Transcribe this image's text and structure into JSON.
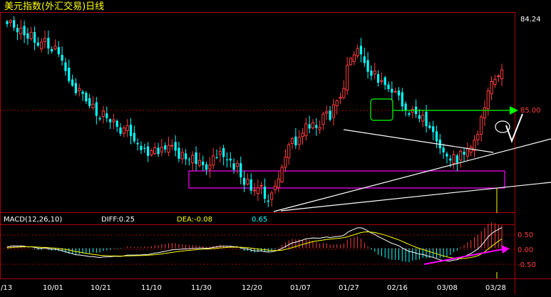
{
  "title": "美元指数(外汇交易)日线",
  "price_labels": {
    "top": "84.24",
    "level": "85.00"
  },
  "macd": {
    "label": "MACD(12,26,10)",
    "diff": "DIFF:0.25",
    "dea": "DEA:-0.08",
    "macd": "0.65",
    "ticks": [
      "0.50",
      "0.00",
      "-0.50"
    ]
  },
  "x_axis": {
    "labels": [
      "/13",
      "10/01",
      "10/21",
      "11/10",
      "11/30",
      "12/20",
      "01/07",
      "01/27",
      "02/16",
      "03/08",
      "03/28"
    ]
  },
  "colors": {
    "up": "#ff3c3c",
    "down": "#00ffff",
    "bg": "#000000",
    "frame": "#aa0000",
    "diff": "#ffffff",
    "dea": "#ffff00",
    "support": "#ff00ff",
    "target": "#00ff00"
  },
  "chart_data": {
    "type": "candlestick",
    "series": [
      {
        "name": "close",
        "values": [
          89.3,
          89.9,
          88.7,
          87.9,
          88.6,
          87.4,
          86.8,
          87.9,
          86.1,
          85.6,
          86.2,
          86.8,
          85.1,
          84.6,
          85.5,
          84.1,
          83.0,
          81.2,
          79.5,
          78.7,
          77.4,
          78.2,
          77.3,
          76.0,
          75.2,
          75.5,
          73.5,
          72.9,
          74.3,
          73.1,
          72.4,
          72.8,
          71.6,
          70.4,
          71.4,
          71.8,
          70.0,
          69.1,
          68.6,
          67.6,
          67.8,
          66.6,
          67.5,
          68.0,
          66.9,
          68.1,
          67.7,
          68.4,
          68.4,
          67.5,
          66.1,
          67.2,
          66.0,
          65.9,
          66.7,
          65.2,
          65.8,
          65.0,
          64.2,
          65.0,
          66.6,
          66.3,
          67.4,
          66.4,
          65.9,
          65.8,
          64.2,
          65.3,
          62.9,
          61.6,
          62.6,
          60.6,
          60.7,
          61.1,
          61.5,
          59.2,
          58.7,
          60.2,
          61.4,
          62.6,
          64.6,
          66.4,
          68.5,
          69.6,
          68.4,
          69.8,
          70.5,
          72.1,
          71.3,
          72.3,
          71.4,
          71.5,
          73.8,
          74.2,
          72.8,
          75.4,
          76.1,
          76.7,
          78.2,
          82.2,
          83.4,
          84.0,
          85.1,
          84.1,
          82.6,
          81.1,
          80.4,
          81.2,
          79.2,
          79.6,
          78.8,
          78.1,
          77.5,
          77.7,
          77.0,
          75.1,
          74.5,
          73.7,
          74.6,
          73.8,
          73.0,
          73.6,
          71.7,
          71.4,
          70.7,
          69.1,
          67.9,
          67.2,
          66.5,
          65.8,
          66.8,
          65.4,
          67.4,
          66.8,
          67.8,
          68.1,
          69.3,
          70.3,
          73.3,
          74.9,
          77.8,
          79.4,
          79.8,
          80.4,
          81.4
        ]
      },
      {
        "name": "MACD DIFF",
        "values": [
          0.11,
          0.18,
          0.21,
          0.2,
          0.22,
          0.18,
          0.12,
          0.13,
          0.07,
          0.0,
          -0.01,
          0.03,
          -0.04,
          -0.1,
          -0.11,
          -0.17,
          -0.24,
          -0.34,
          -0.45,
          -0.54,
          -0.64,
          -0.66,
          -0.7,
          -0.76,
          -0.81,
          -0.81,
          -0.87,
          -0.9,
          -0.85,
          -0.84,
          -0.83,
          -0.79,
          -0.79,
          -0.8,
          -0.74,
          -0.67,
          -0.67,
          -0.67,
          -0.66,
          -0.66,
          -0.62,
          -0.62,
          -0.56,
          -0.48,
          -0.45,
          -0.37,
          -0.31,
          -0.23,
          -0.16,
          -0.12,
          -0.12,
          -0.08,
          -0.07,
          -0.06,
          -0.02,
          -0.02,
          0.0,
          0.0,
          -0.01,
          0.01,
          0.08,
          0.12,
          0.18,
          0.19,
          0.19,
          0.19,
          0.14,
          0.13,
          0.04,
          -0.06,
          -0.09,
          -0.19,
          -0.25,
          -0.27,
          -0.27,
          -0.34,
          -0.38,
          -0.35,
          -0.28,
          -0.18,
          -0.02,
          0.15,
          0.34,
          0.51,
          0.58,
          0.69,
          0.78,
          0.91,
          0.94,
          0.99,
          0.98,
          0.96,
          1.04,
          1.08,
          1.03,
          1.08,
          1.13,
          1.16,
          1.25,
          1.51,
          1.7,
          1.84,
          1.97,
          1.97,
          1.85,
          1.66,
          1.47,
          1.35,
          1.12,
          0.97,
          0.8,
          0.63,
          0.47,
          0.36,
          0.23,
          0.02,
          -0.15,
          -0.32,
          -0.38,
          -0.48,
          -0.58,
          -0.6,
          -0.73,
          -0.81,
          -0.89,
          -1.01,
          -1.13,
          -1.2,
          -1.23,
          -1.25,
          -1.15,
          -1.13,
          -0.95,
          -0.84,
          -0.67,
          -0.52,
          -0.3,
          -0.08,
          0.25,
          0.65,
          1.09,
          1.41,
          1.64,
          1.82,
          2.0
        ]
      },
      {
        "name": "MACD DEA",
        "values": [
          0.02,
          0.05,
          0.08,
          0.1,
          0.12,
          0.13,
          0.13,
          0.13,
          0.12,
          0.1,
          0.08,
          0.07,
          0.05,
          0.02,
          0.0,
          -0.03,
          -0.07,
          -0.12,
          -0.18,
          -0.25,
          -0.32,
          -0.38,
          -0.44,
          -0.5,
          -0.55,
          -0.6,
          -0.65,
          -0.69,
          -0.71,
          -0.73,
          -0.75,
          -0.76,
          -0.76,
          -0.77,
          -0.76,
          -0.75,
          -0.74,
          -0.73,
          -0.72,
          -0.71,
          -0.7,
          -0.68,
          -0.66,
          -0.63,
          -0.6,
          -0.56,
          -0.51,
          -0.46,
          -0.41,
          -0.36,
          -0.32,
          -0.28,
          -0.24,
          -0.21,
          -0.18,
          -0.15,
          -0.12,
          -0.1,
          -0.08,
          -0.07,
          -0.04,
          -0.01,
          0.02,
          0.05,
          0.07,
          0.09,
          0.1,
          0.1,
          0.09,
          0.07,
          0.04,
          0.0,
          -0.04,
          -0.08,
          -0.11,
          -0.15,
          -0.19,
          -0.22,
          -0.23,
          -0.22,
          -0.19,
          -0.13,
          -0.04,
          0.06,
          0.16,
          0.26,
          0.36,
          0.46,
          0.55,
          0.63,
          0.69,
          0.74,
          0.79,
          0.84,
          0.87,
          0.91,
          0.94,
          0.98,
          1.02,
          1.1,
          1.2,
          1.3,
          1.41,
          1.51,
          1.57,
          1.58,
          1.55,
          1.52,
          1.44,
          1.36,
          1.26,
          1.15,
          1.04,
          0.92,
          0.8,
          0.66,
          0.51,
          0.36,
          0.22,
          0.09,
          -0.03,
          -0.13,
          -0.24,
          -0.34,
          -0.44,
          -0.54,
          -0.65,
          -0.75,
          -0.84,
          -0.92,
          -0.96,
          -1.01,
          -1.01,
          -1.0,
          -0.96,
          -0.9,
          -0.83,
          -0.73,
          -0.57,
          -0.35,
          -0.09,
          0.17,
          0.43,
          0.68,
          0.9
        ]
      }
    ],
    "ylim": [
      57,
      91
    ],
    "macd_ylim": [
      -2.8,
      2.1
    ]
  }
}
